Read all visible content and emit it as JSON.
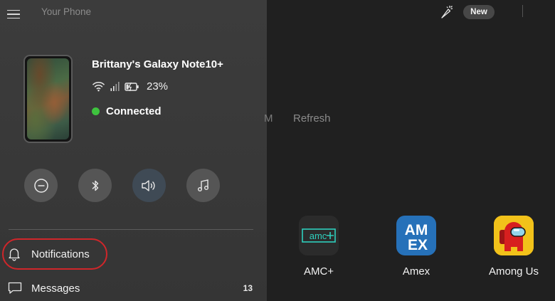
{
  "header": {
    "app_title": "Your Phone",
    "new_badge": "New"
  },
  "phone": {
    "name": "Brittany's Galaxy Note10+",
    "battery": "23%",
    "connection": "Connected",
    "connection_color": "#3ec33e"
  },
  "quick_actions": [
    {
      "name": "do-not-disturb",
      "icon": "minus-circle-icon"
    },
    {
      "name": "bluetooth",
      "icon": "bluetooth-icon"
    },
    {
      "name": "volume",
      "icon": "speaker-icon",
      "active": true
    },
    {
      "name": "music",
      "icon": "music-note-icon"
    }
  ],
  "nav": {
    "notifications": {
      "label": "Notifications",
      "icon": "bell-icon",
      "highlighted": true
    },
    "messages": {
      "label": "Messages",
      "icon": "chat-bubble-icon",
      "badge": "13"
    }
  },
  "main": {
    "cut_text": "M",
    "refresh": "Refresh"
  },
  "apps": [
    {
      "label": "AMC+",
      "icon": "amc-plus-icon",
      "color": "#2ecfbd"
    },
    {
      "label": "Amex",
      "icon": "amex-icon",
      "color": "#2671b9"
    },
    {
      "label": "Among Us",
      "icon": "among-us-icon",
      "color": "#d71f1f"
    }
  ],
  "colors": {
    "pane_bg": "#383838",
    "main_bg": "#202020",
    "highlight": "#d0262a"
  }
}
